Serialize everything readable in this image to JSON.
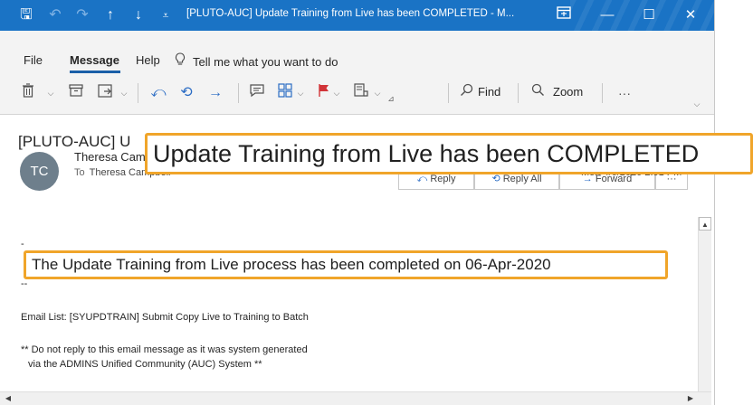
{
  "window": {
    "title": "[PLUTO-AUC] Update Training from Live has been COMPLETED  -  M...",
    "controls": {
      "minimize": "—",
      "maximize": "☐",
      "close": "✕"
    }
  },
  "quick_access": {
    "save": "🖫",
    "undo": "↶",
    "redo": "↷",
    "up": "↑",
    "down": "↓",
    "customize": "⩡"
  },
  "menu": {
    "items": [
      "File",
      "Message",
      "Help"
    ],
    "tell_me": "Tell me what you want to do"
  },
  "ribbon": {
    "find_label": "Find",
    "zoom_label": "Zoom",
    "more": "···"
  },
  "email": {
    "subject": "[PLUTO-AUC] U",
    "sender_initials": "TC",
    "sender_name": "Theresa Campbell",
    "to_label": "To",
    "to_name": "Theresa Campbell",
    "sent_date": "Mon 4/6/2020 2:01 PM",
    "actions": [
      "Reply",
      "Reply All",
      "Forward"
    ],
    "body": {
      "line1": "-",
      "line2": "--",
      "email_list": "Email List: [SYUPDTRAIN] Submit Copy Live to Training to Batch",
      "disclaimer1": "** Do not reply to this email message as it was system generated",
      "disclaimer2": "via the ADMINS Unified Community (AUC) System **"
    }
  },
  "callouts": {
    "subject": "Update Training from Live has been COMPLETED",
    "body": "The Update Training from Live process has been completed on 06-Apr-2020"
  },
  "colors": {
    "titlebar": "#1a73c5",
    "callout_border": "#f0a52a",
    "avatar": "#6e7f8c"
  }
}
